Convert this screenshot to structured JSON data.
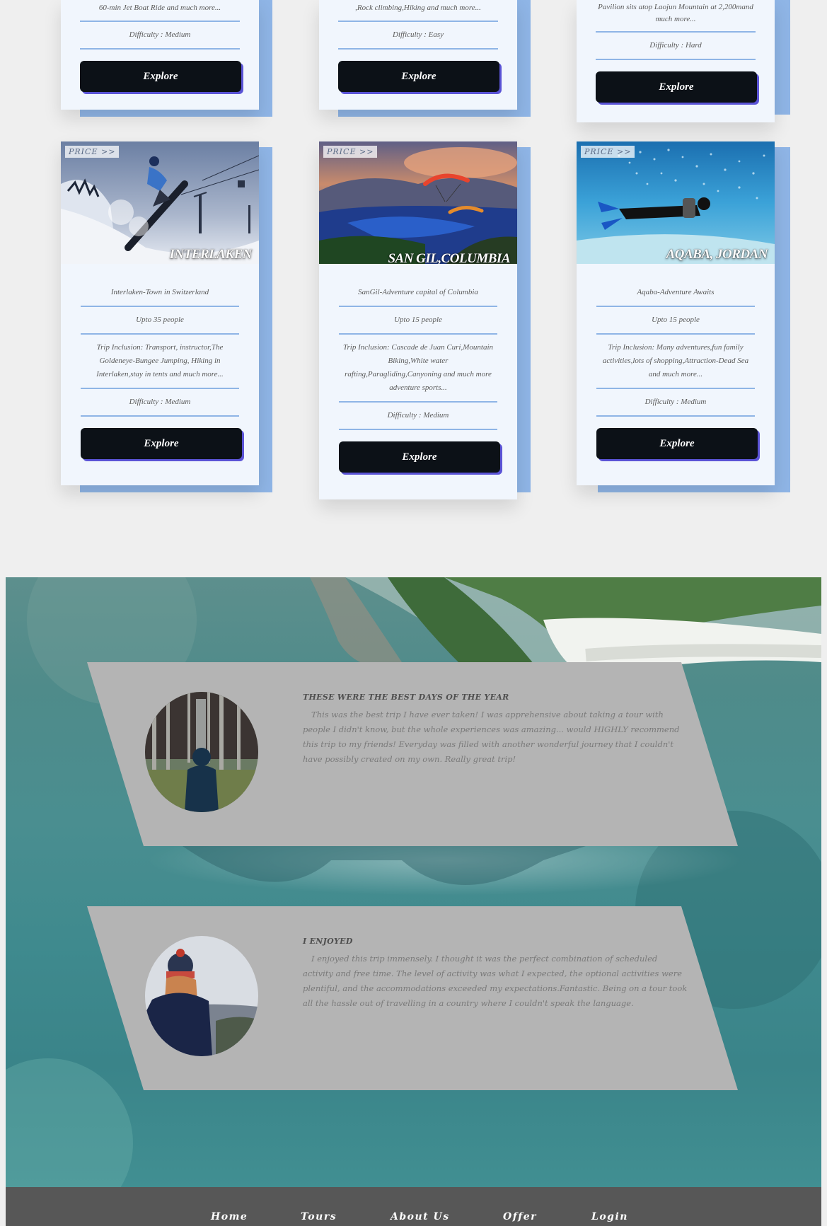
{
  "cards_top": [
    {
      "snippet": "60-min Jet Boat Ride and much more...",
      "difficulty": "Difficulty : Medium",
      "button": "Explore"
    },
    {
      "snippet": ",Rock climbing,Hiking and much more...",
      "difficulty": "Difficulty : Easy",
      "button": "Explore"
    },
    {
      "snippet": "Pavilion sits atop Laojun Mountain at 2,200mand much more...",
      "difficulty": "Difficulty : Hard",
      "button": "Explore"
    }
  ],
  "cards": [
    {
      "price": "PRICE >>",
      "place": "INTERLAKEN",
      "subtitle": "Interlaken-Town in Switzerland",
      "capacity": "Upto 35 people",
      "inclusion": "Trip Inclusion: Transport, instructor,The Goldeneye-Bungee Jumping, Hiking in Interlaken,stay in tents and much more...",
      "difficulty": "Difficulty : Medium",
      "button": "Explore"
    },
    {
      "price": "PRICE >>",
      "place": "SAN GIL,COLUMBIA",
      "subtitle": "SanGil-Adventure capital of Columbia",
      "capacity": "Upto 15 people",
      "inclusion": "Trip Inclusion: Cascade de Juan Curi,Mountain Biking,White water rafting,Paragliding,Canyoning and much more adventure sports...",
      "difficulty": "Difficulty : Medium",
      "button": "Explore"
    },
    {
      "price": "PRICE >>",
      "place": "AQABA, JORDAN",
      "subtitle": "Aqaba-Adventure Awaits",
      "capacity": "Upto 15 people",
      "inclusion": "Trip Inclusion: Many adventures,fun family activities,lots of shopping,Attraction-Dead Sea and much more...",
      "difficulty": "Difficulty : Medium",
      "button": "Explore"
    }
  ],
  "testimonials": [
    {
      "title": "THESE WERE THE BEST DAYS OF THE YEAR",
      "text": "This was the best trip I have ever taken! I was apprehensive about taking a tour with people I didn't know, but the whole experiences was amazing... would HIGHLY recommend this trip to my friends! Everyday was filled with another wonderful journey that I couldn't have possibly created on my own. Really great trip!"
    },
    {
      "title": "I ENJOYED",
      "text": "I enjoyed this trip immensely. I thought it was the perfect combination of scheduled activity and free time. The level of activity was what I expected, the optional activities were plentiful, and the accommodations exceeded my expectations.Fantastic. Being on a tour took all the hassle out of travelling in a country where I couldn't speak the language."
    }
  ],
  "footer": {
    "nav": [
      "Home",
      "Tours",
      "About Us",
      "Offer",
      "Login"
    ]
  },
  "colors": {
    "page_bg": "#efefef",
    "card_bg": "#f1f6fd",
    "card_accent": "#8fb5e6",
    "button_bg": "#0c1117",
    "button_shadow": "#5b54d6",
    "testimonial_panel": "#b4b4b4",
    "footer_bg": "#575757"
  }
}
